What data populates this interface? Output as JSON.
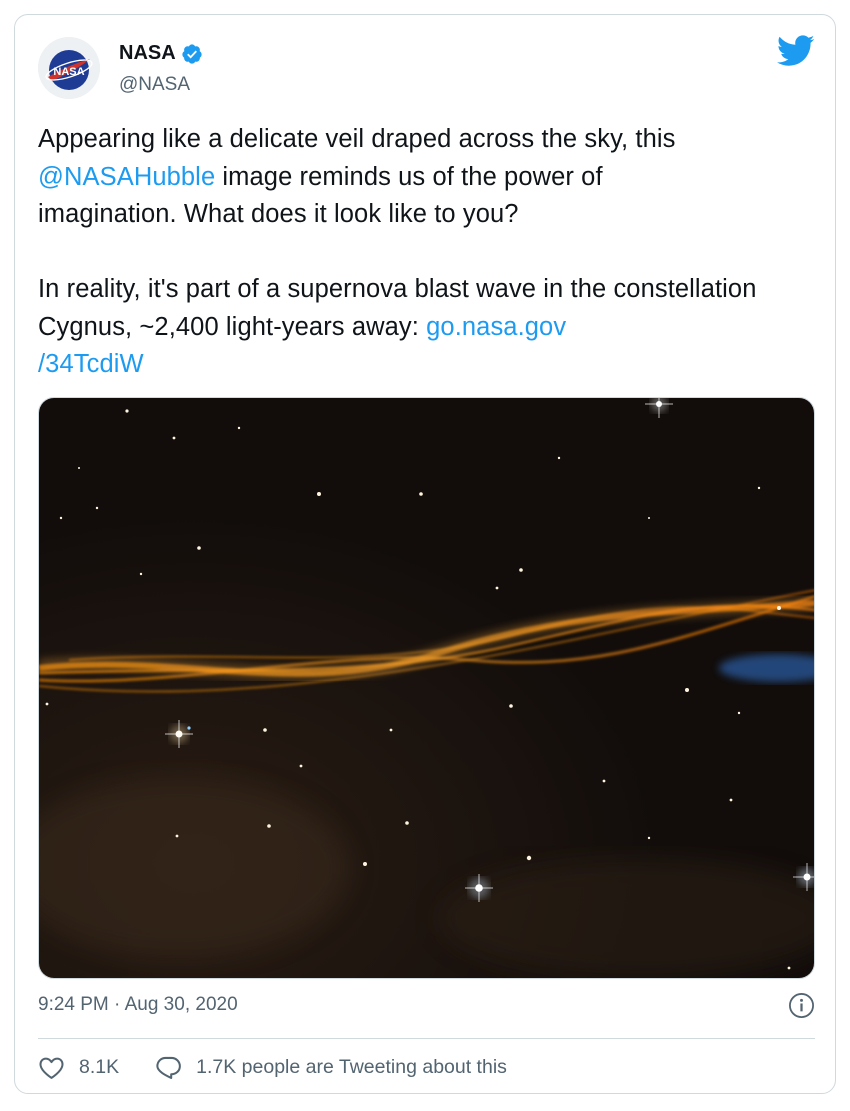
{
  "author": {
    "name": "NASA",
    "handle": "@NASA",
    "avatar_logo_text": "NASA",
    "verified_icon": "verified-badge-icon"
  },
  "brand_icon": "twitter-bird-icon",
  "tweet": {
    "line1_text": "Appearing like a delicate veil draped across the sky, this",
    "mention": "@NASAHubble",
    "line2_rest": " image reminds us of the power of",
    "line3_text": "imagination. What does it look like to you?",
    "para2_text": "In reality, it's part of a supernova blast wave in the constellation Cygnus, ~2,400 light-years away: ",
    "link_part1": "go.nasa.gov",
    "link_part2": "/34TcdiW"
  },
  "media": {
    "description_icon": "hubble-photo-image"
  },
  "timestamp": "9:24 PM · Aug 30, 2020",
  "actions": {
    "like_count": "8.1K",
    "tweeting_text": "1.7K people are Tweeting about this"
  },
  "colors": {
    "accent": "#1d9bf0",
    "text": "#0f1419",
    "secondary": "#536471",
    "border": "#cfd9de"
  }
}
